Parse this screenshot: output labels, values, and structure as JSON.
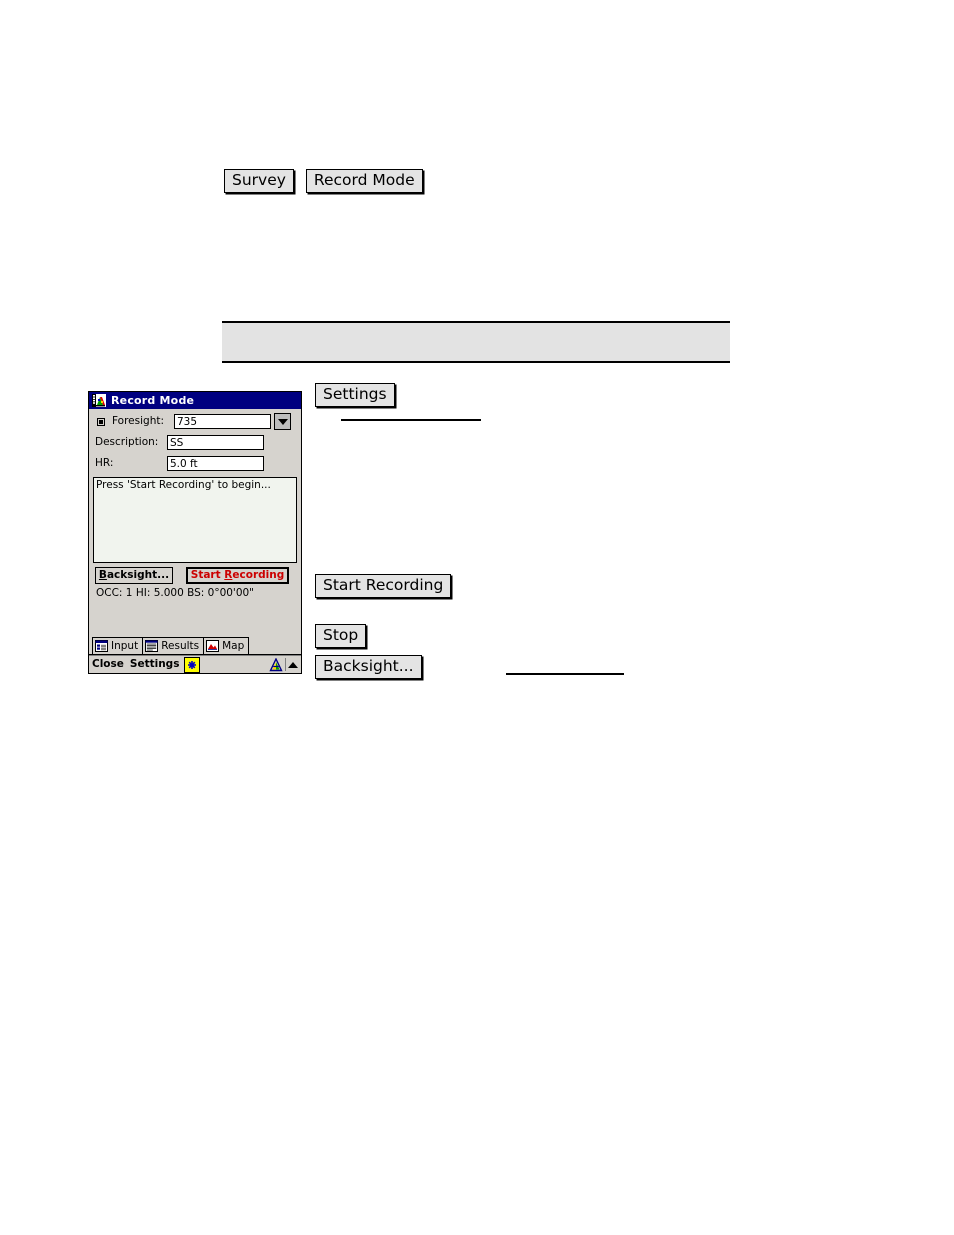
{
  "manual": {
    "top_keys": [
      {
        "label": "Survey",
        "name": "key-survey"
      },
      {
        "label": "Record Mode",
        "name": "key-record-mode"
      }
    ],
    "notice_banner_text": "",
    "side_keys": [
      {
        "label": "Settings",
        "name": "key-settings"
      },
      {
        "label": "Start Recording",
        "name": "key-start-recording"
      },
      {
        "label": "Stop",
        "name": "key-stop"
      },
      {
        "label": "Backsight...",
        "name": "key-backsight"
      }
    ]
  },
  "device": {
    "titlebar": {
      "title": "Record Mode",
      "icon": "record-mode-app-icon"
    },
    "fields": {
      "foresight": {
        "label": "Foresight:",
        "value": "735",
        "marker": "radio-selected-marker",
        "dropdown_icon": "chevron-down-icon"
      },
      "description": {
        "label": "Description:",
        "value": "SS"
      },
      "hr": {
        "label": "HR:",
        "value": "5.0 ft"
      }
    },
    "message_box": {
      "text": "Press 'Start Recording' to begin..."
    },
    "buttons": {
      "backsight": {
        "accel": "B",
        "rest": "acksight..."
      },
      "start_recording": {
        "word1": "Start",
        "accel": "R",
        "rest": "ecording",
        "color": "#cc0000"
      }
    },
    "status_line": "OCC: 1  HI: 5.000  BS: 0°00'00\"",
    "tabs": [
      {
        "label": "Input",
        "icon": "input-form-icon",
        "active": true
      },
      {
        "label": "Results",
        "icon": "results-list-icon",
        "active": false
      },
      {
        "label": "Map",
        "icon": "map-peak-icon",
        "active": false
      }
    ],
    "statusbar": {
      "close_label": "Close",
      "settings_label": "Settings",
      "star_icon": "blue-asterisk-icon",
      "tripod_icon": "survey-tripod-icon",
      "scroll_icon": "scroll-up-arrow-icon"
    }
  },
  "colors": {
    "titlebar_bg": "#000080",
    "window_face": "#d6d3ce",
    "keycap_face": "#e4e4e4",
    "banner_bg": "#e3e3e3",
    "accent_red": "#cc0000",
    "star_yellow": "#ffff00"
  }
}
